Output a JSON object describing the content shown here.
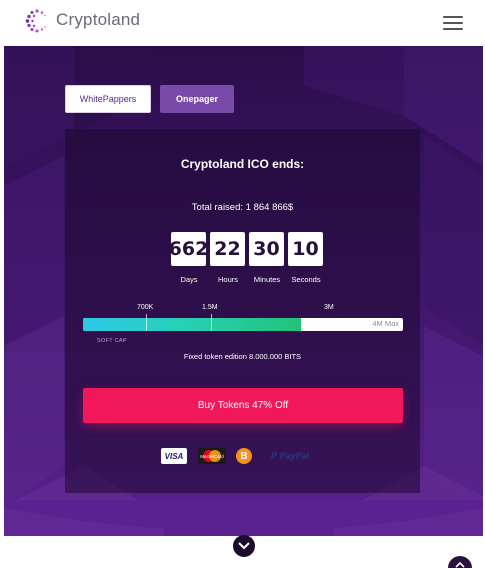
{
  "header": {
    "brand": "Cryptoland"
  },
  "tabs": {
    "whitepapers_label": "WhitePappers",
    "onepager_label": "Onepager"
  },
  "ico": {
    "title": "Cryptoland ICO ends:",
    "total_raised": "Total raised: 1 864 866$"
  },
  "countdown": [
    {
      "value": "662",
      "label": "Days"
    },
    {
      "value": "22",
      "label": "Hours"
    },
    {
      "value": "30",
      "label": "Minutes"
    },
    {
      "value": "10",
      "label": "Seconds"
    }
  ],
  "progress": {
    "ticks": [
      "700K",
      "1.5M",
      "3M"
    ],
    "max_label": "4M Max",
    "fill_fraction": 0.68,
    "soft_cap_label": "SOFT CAP",
    "fixed_text": "Fixed token edition 8.000.000 BITS"
  },
  "buy": {
    "label": "Buy Tokens 47% Off"
  },
  "payments": {
    "visa": "VISA",
    "mastercard": "MasterCard",
    "bitcoin": "B",
    "paypal": "PayPal"
  },
  "icons": {
    "logo": "cryptoland-logo-icon",
    "menu": "hamburger-menu-icon",
    "scroll": "chevron-down-icon",
    "top": "chevron-up-icon"
  },
  "colors": {
    "accent": "#f0185a",
    "purple": "#7a4aa8",
    "progress_start": "#2cc9e6",
    "progress_end": "#23c277"
  }
}
